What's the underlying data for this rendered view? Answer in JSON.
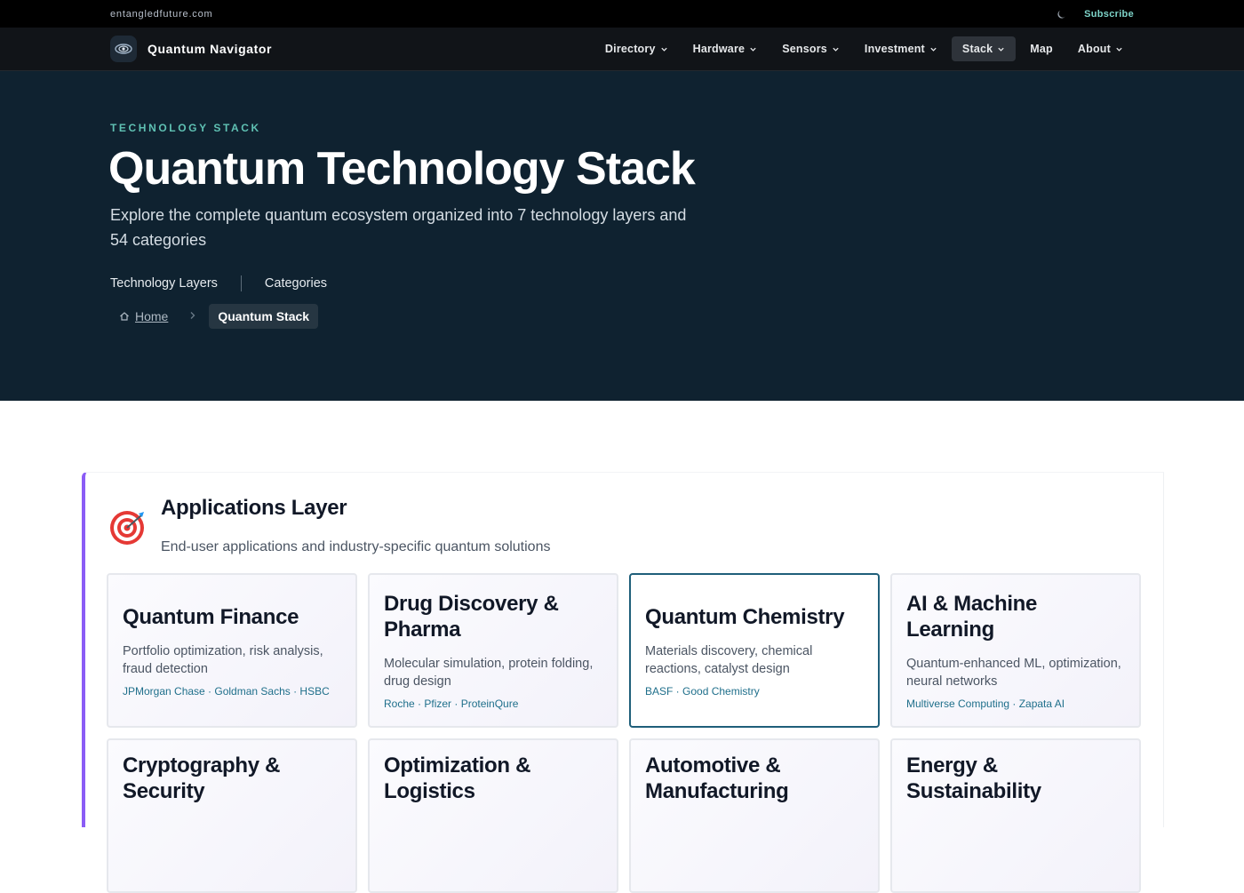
{
  "topbar": {
    "domain": "entangledfuture.com",
    "subscribe": "Subscribe",
    "theme_icon": "moon-icon"
  },
  "brand": {
    "name": "Quantum Navigator",
    "logo_icon": "atom-logo-icon"
  },
  "nav": {
    "items": [
      {
        "label": "Directory",
        "has_dropdown": true,
        "active": false
      },
      {
        "label": "Hardware",
        "has_dropdown": true,
        "active": false
      },
      {
        "label": "Sensors",
        "has_dropdown": true,
        "active": false
      },
      {
        "label": "Investment",
        "has_dropdown": true,
        "active": false
      },
      {
        "label": "Stack",
        "has_dropdown": true,
        "active": true
      },
      {
        "label": "Map",
        "has_dropdown": false,
        "active": false
      },
      {
        "label": "About",
        "has_dropdown": true,
        "active": false
      }
    ]
  },
  "hero": {
    "eyebrow": "TECHNOLOGY STACK",
    "title": "Quantum Technology Stack",
    "subtitle": "Explore the complete quantum ecosystem organized into 7 technology layers and 54 categories",
    "stats": [
      "Technology Layers",
      "Categories"
    ],
    "breadcrumb": {
      "home": "Home",
      "current": "Quantum Stack"
    }
  },
  "layer": {
    "icon": "target-icon",
    "accent": "#8b5cf6",
    "title": "Applications Layer",
    "description": "End-user applications and industry-specific quantum solutions",
    "cards": [
      {
        "title": "Quantum Finance",
        "description": "Portfolio optimization, risk analysis, fraud detection",
        "companies": "JPMorgan Chase · Goldman Sachs · HSBC"
      },
      {
        "title": "Drug Discovery & Pharma",
        "description": "Molecular simulation, protein folding, drug design",
        "companies": "Roche · Pfizer · ProteinQure"
      },
      {
        "title": "Quantum Chemistry",
        "description": "Materials discovery, chemical reactions, catalyst design",
        "companies": "BASF · Good Chemistry"
      },
      {
        "title": "AI & Machine Learning",
        "description": "Quantum-enhanced ML, optimization, neural networks",
        "companies": "Multiverse Computing · Zapata AI"
      },
      {
        "title": "Cryptography & Security",
        "description": "",
        "companies": ""
      },
      {
        "title": "Optimization & Logistics",
        "description": "",
        "companies": ""
      },
      {
        "title": "Automotive & Manufacturing",
        "description": "",
        "companies": ""
      },
      {
        "title": "Energy & Sustainability",
        "description": "",
        "companies": ""
      }
    ]
  }
}
